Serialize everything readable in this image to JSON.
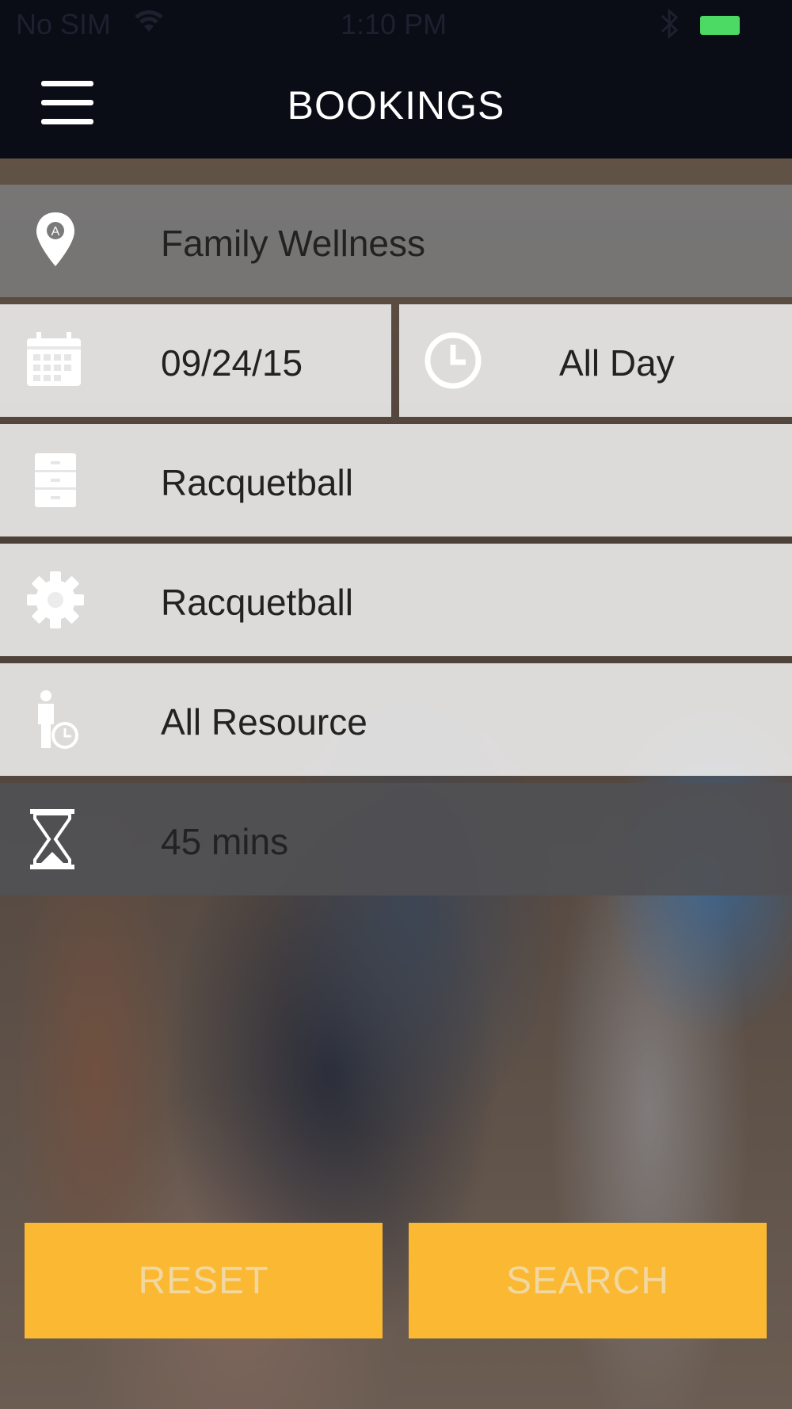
{
  "status_bar": {
    "carrier": "No SIM",
    "time": "1:10 PM"
  },
  "header": {
    "title": "BOOKINGS"
  },
  "form": {
    "location": "Family Wellness",
    "date": "09/24/15",
    "time": "All Day",
    "facility": "Racquetball",
    "activity": "Racquetball",
    "resource": "All Resource",
    "duration": "45 mins"
  },
  "actions": {
    "reset_label": "RESET",
    "search_label": "SEARCH"
  },
  "colors": {
    "header_bg": "#0a0c16",
    "accent": "#fbb833",
    "battery": "#4cd964"
  }
}
